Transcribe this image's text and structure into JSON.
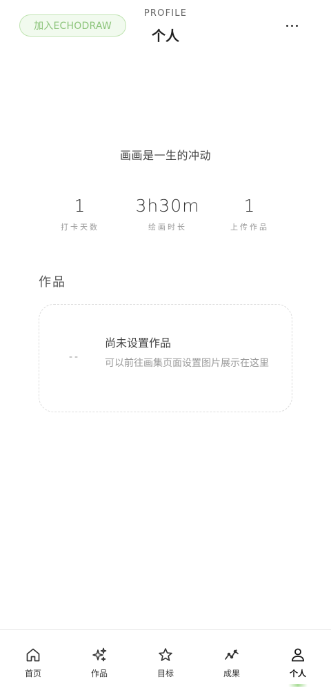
{
  "header": {
    "join_label": "加入ECHODRAW",
    "subtitle": "PROFILE",
    "title": "个人"
  },
  "motto": "画画是一生的冲动",
  "stats": [
    {
      "value": "1",
      "label": "打卡天数"
    },
    {
      "value": "3h30m",
      "label": "绘画时长"
    },
    {
      "value": "1",
      "label": "上传作品"
    }
  ],
  "works": {
    "section_title": "作品",
    "placeholder": "--",
    "empty_title": "尚未设置作品",
    "empty_desc": "可以前往画集页面设置图片展示在这里"
  },
  "nav": {
    "items": [
      {
        "label": "首页",
        "icon": "home-icon"
      },
      {
        "label": "作品",
        "icon": "sparkles-icon"
      },
      {
        "label": "目标",
        "icon": "star-icon"
      },
      {
        "label": "成果",
        "icon": "chart-line-icon"
      },
      {
        "label": "个人",
        "icon": "user-icon",
        "active": true
      }
    ]
  },
  "colors": {
    "accent_green": "#8cc47a",
    "accent_green_bg": "#f1faee"
  }
}
